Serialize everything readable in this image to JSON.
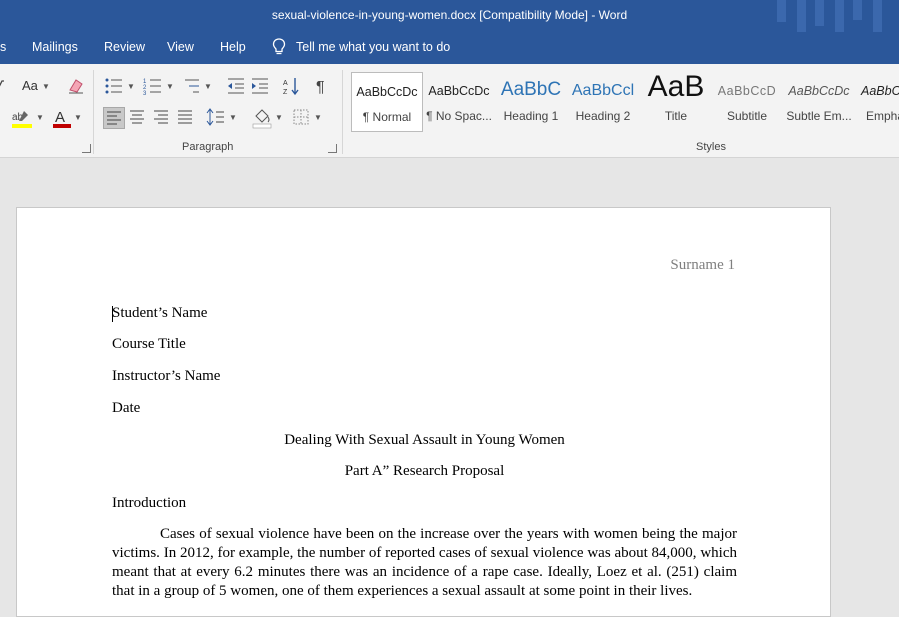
{
  "titlebar": {
    "title": "sexual-violence-in-young-women.docx [Compatibility Mode]  -  Word"
  },
  "tabs": [
    {
      "label": "s"
    },
    {
      "label": "Mailings"
    },
    {
      "label": "Review"
    },
    {
      "label": "View"
    },
    {
      "label": "Help"
    }
  ],
  "tell_me": {
    "label": "Tell me what you want to do",
    "icon": "lightbulb-icon"
  },
  "ribbon": {
    "font_group": {
      "change_case": "Aa"
    },
    "paragraph_group": {
      "label": "Paragraph"
    },
    "styles_group": {
      "label": "Styles",
      "items": [
        {
          "sample": "AaBbCcDc",
          "name": "¶ Normal",
          "selected": true
        },
        {
          "sample": "AaBbCcDc",
          "name": "¶ No Spac..."
        },
        {
          "sample": "AaBbC",
          "name": "Heading 1"
        },
        {
          "sample": "AaBbCcl",
          "name": "Heading 2"
        },
        {
          "sample": "AaB",
          "name": "Title"
        },
        {
          "sample": "AaBbCcD",
          "name": "Subtitle"
        },
        {
          "sample": "AaBbCcDc",
          "name": "Subtle Em..."
        },
        {
          "sample": "AaBbCcDc",
          "name": "Empha"
        }
      ]
    },
    "colors": {
      "highlight": "#ffff00",
      "font_color": "#c00000"
    }
  },
  "document": {
    "header": "Surname 1",
    "lines": [
      "Student’s Name",
      "Course Title",
      "Instructor’s Name",
      "Date"
    ],
    "title": "Dealing With Sexual Assault in Young Women",
    "subtitle": "Part A” Research Proposal",
    "section": "Introduction",
    "paragraph": "Cases of sexual violence have been on the increase over the years with women being the major victims. In 2012, for example, the number of reported cases of sexual violence was about 84,000, which meant that at every 6.2 minutes there was an incidence of a rape case. Ideally, Loez et al. (251) claim that in a group of 5 women, one of them experiences a sexual assault at some point in their lives."
  },
  "theme": {
    "accent": "#2b579a"
  }
}
